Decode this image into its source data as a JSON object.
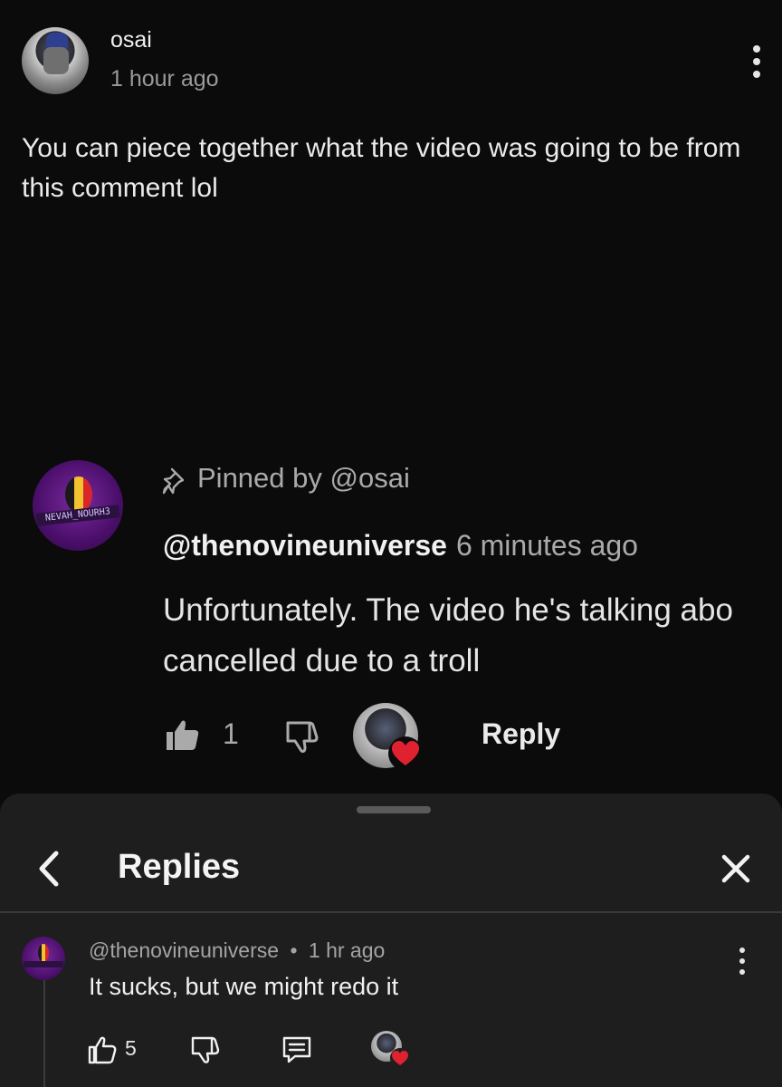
{
  "top_comment": {
    "username": "osai",
    "time": "1 hour ago",
    "text": "You can piece together what the video was going to be from this comment lol"
  },
  "embedded_comment": {
    "pinned_text": "Pinned by @osai",
    "handle": "@thenovineuniverse",
    "time": "6 minutes ago",
    "text_line1": "Unfortunately. The video he's talking abo",
    "text_line2": "cancelled due to a troll",
    "like_count": "1",
    "reply_label": "Reply",
    "avatar_banner_text": "NEVAH_NOURH3"
  },
  "replies_sheet": {
    "title": "Replies",
    "reply": {
      "handle": "@thenovineuniverse",
      "separator": "•",
      "time": "1 hr ago",
      "text": "It sucks, but we might redo it",
      "like_count": "5"
    }
  },
  "colors": {
    "background": "#0b0b0b",
    "sheet": "#1e1e1e",
    "heart": "#e0212f",
    "secondary_text": "#aaaaaa"
  },
  "icons": [
    "pin-icon",
    "like-icon",
    "dislike-icon",
    "heart-icon",
    "back-icon",
    "close-icon",
    "more-icon",
    "comment-icon"
  ]
}
